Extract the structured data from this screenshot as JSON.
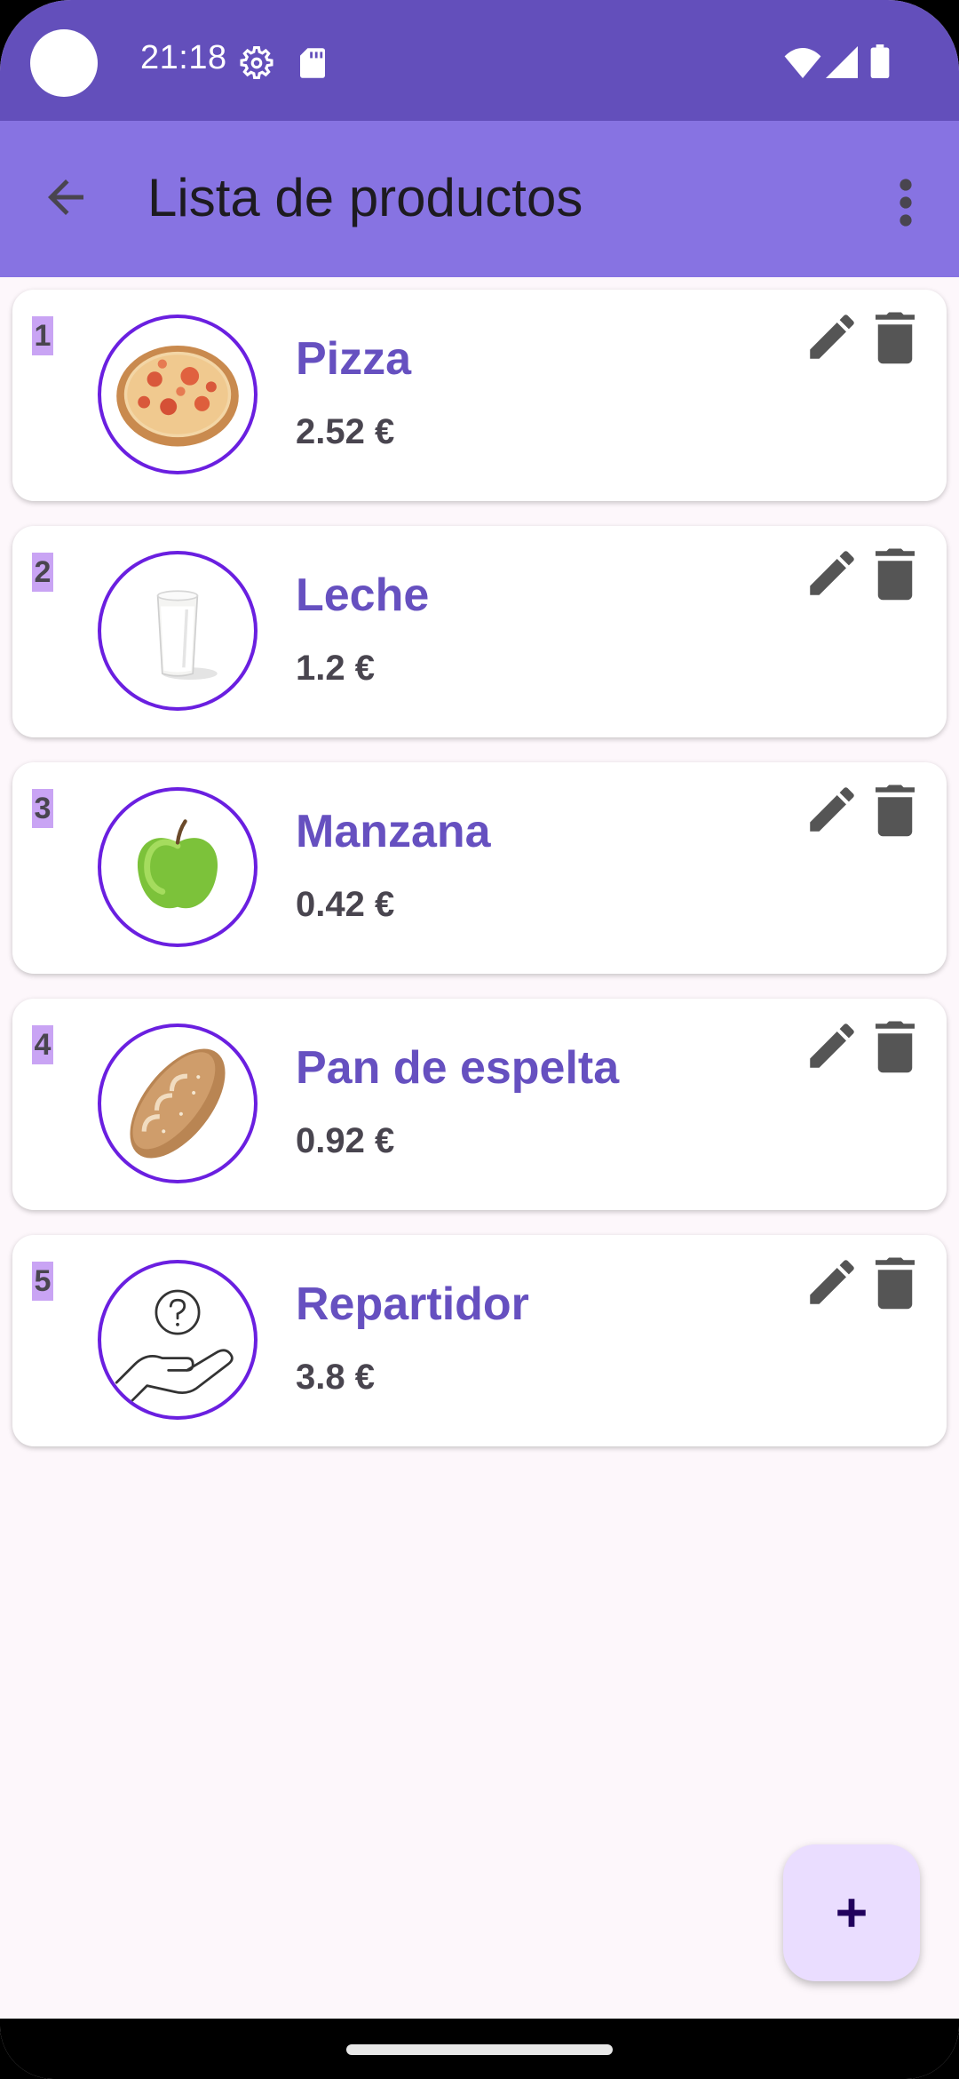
{
  "status_bar": {
    "time": "21:18",
    "icons": [
      "settings-icon",
      "sd-card-icon",
      "wifi-icon",
      "signal-icon",
      "battery-icon"
    ],
    "background": "#634fbb"
  },
  "app_bar": {
    "title": "Lista de productos",
    "background": "#8773e2",
    "icons": [
      "back-arrow-icon",
      "more-vert-icon"
    ]
  },
  "products": [
    {
      "index": "1",
      "name": "Pizza",
      "price": "2.52 €",
      "image": "pizza"
    },
    {
      "index": "2",
      "name": "Leche",
      "price": "1.2 €",
      "image": "milk-glass"
    },
    {
      "index": "3",
      "name": "Manzana",
      "price": "0.42 €",
      "image": "green-apple"
    },
    {
      "index": "4",
      "name": "Pan de espelta",
      "price": "0.92 €",
      "image": "bread-loaf"
    },
    {
      "index": "5",
      "name": "Repartidor",
      "price": "3.8 €",
      "image": "hand-question-icon"
    }
  ],
  "card_actions": [
    "edit-icon",
    "delete-icon"
  ],
  "fab": {
    "icon": "add-icon",
    "background": "#eaddff"
  },
  "colors": {
    "accent": "#6650c0",
    "avatar_border": "#6a1fe0",
    "index_badge": "#c9a4f4",
    "page_background": "#fdf7fb"
  }
}
